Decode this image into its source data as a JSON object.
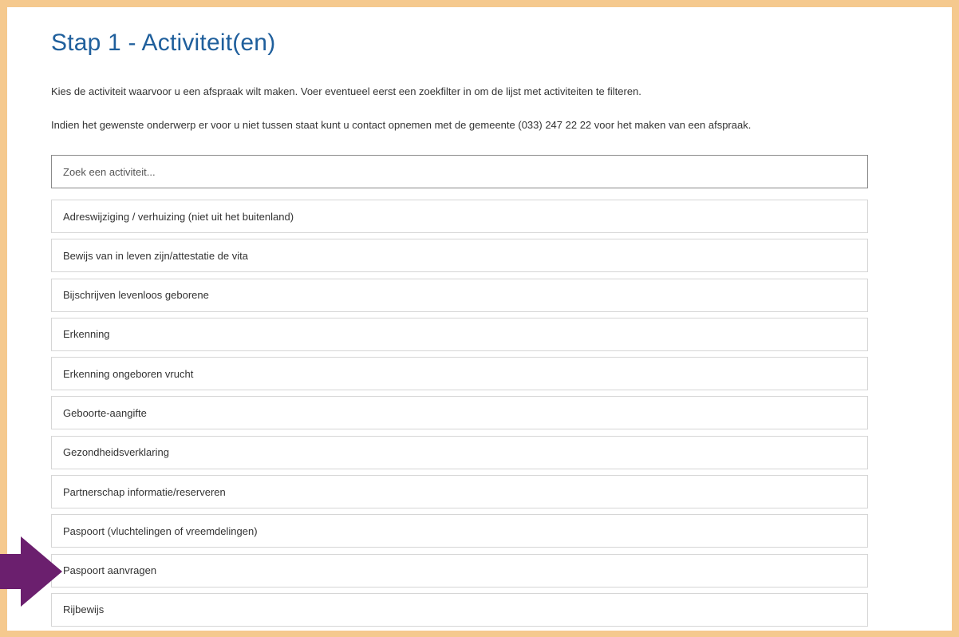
{
  "page": {
    "title": "Stap 1 - Activiteit(en)",
    "intro_line_1": "Kies de activiteit waarvoor u een afspraak wilt maken. Voer eventueel eerst een zoekfilter in om de lijst met activiteiten te filteren.",
    "intro_line_2": "Indien het gewenste onderwerp er voor u niet tussen staat kunt u  contact opnemen met de gemeente (033) 247 22 22 voor het maken van een afspraak."
  },
  "search": {
    "placeholder": "Zoek een activiteit...",
    "value": ""
  },
  "activities": [
    "Adreswijziging / verhuizing (niet uit het buitenland)",
    "Bewijs van in leven zijn/attestatie de vita",
    "Bijschrijven levenloos geborene",
    "Erkenning",
    "Erkenning ongeboren vrucht",
    "Geboorte-aangifte",
    "Gezondheidsverklaring",
    "Partnerschap informatie/reserveren",
    "Paspoort (vluchtelingen of vreemdelingen)",
    "Paspoort aanvragen",
    "Rijbewijs"
  ],
  "annotation": {
    "icon": "arrow-right-icon",
    "color": "#6b1f6e",
    "points_to": "Paspoort aanvragen"
  },
  "colors": {
    "frame": "#f5c98e",
    "title": "#1f5f9c",
    "arrow": "#6b1f6e"
  }
}
